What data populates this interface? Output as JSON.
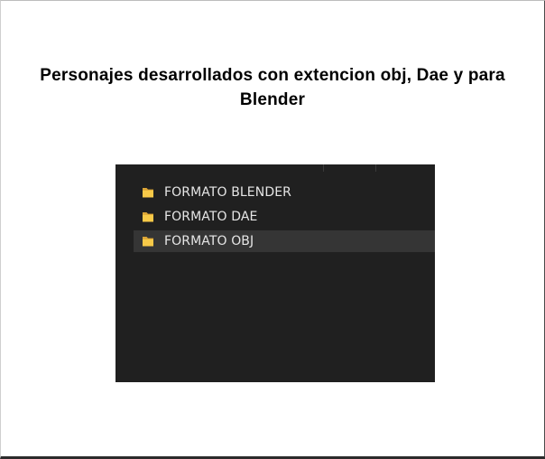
{
  "heading": {
    "line1": "Personajes desarrollados con extencion obj, Dae y para",
    "line2": "Blender"
  },
  "explorer": {
    "background": "#202020",
    "selected_background": "#353535",
    "folder_icon": "folder-icon",
    "folder_color": "#f7c948",
    "items": [
      {
        "label": "FORMATO BLENDER",
        "selected": false
      },
      {
        "label": "FORMATO DAE",
        "selected": false
      },
      {
        "label": "FORMATO OBJ",
        "selected": true
      }
    ]
  }
}
